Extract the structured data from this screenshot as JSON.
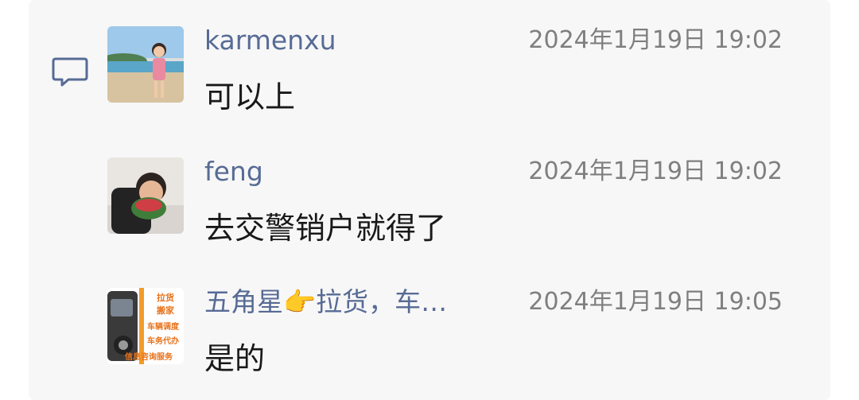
{
  "icon": "comment-bubble-icon",
  "colors": {
    "panel_bg": "#f7f7f7",
    "username": "#576b95",
    "timestamp": "#7f7f7f",
    "text": "#191919"
  },
  "comments": [
    {
      "username": "karmenxu",
      "timestamp": "2024年1月19日 19:02",
      "message": "可以上"
    },
    {
      "username": "feng",
      "timestamp": "2024年1月19日 19:02",
      "message": "去交警销户就得了"
    },
    {
      "username": "五角星👉拉货，车…",
      "timestamp": "2024年1月19日 19:05",
      "message": "是的",
      "avatar_text": [
        "拉货",
        "搬家",
        "车辆调度",
        "车务代办",
        "信息咨询服务"
      ]
    }
  ]
}
